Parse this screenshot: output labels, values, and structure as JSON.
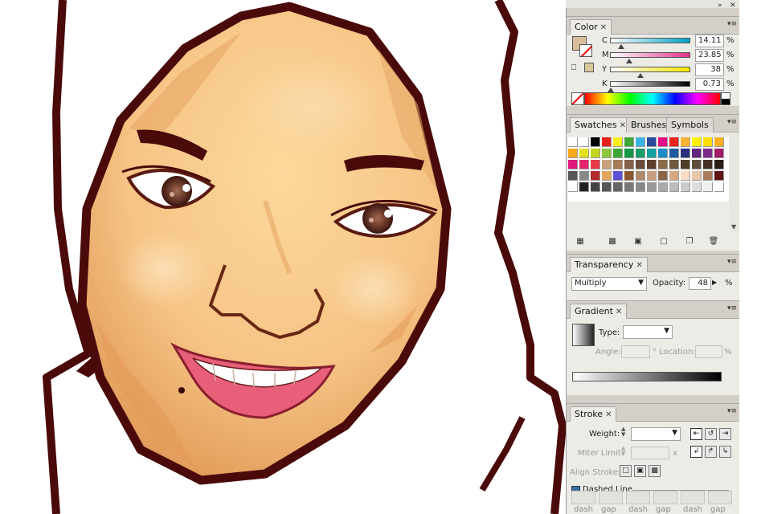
{
  "window": {
    "collapse_icon": "double-arrow-icon",
    "close_icon": "x-icon"
  },
  "color_panel": {
    "tab": "Color",
    "channels": [
      {
        "label": "C",
        "value": "14.11",
        "unit": "%",
        "gradient": [
          "#ffffff",
          "#00a0c6"
        ],
        "level": 0.1411
      },
      {
        "label": "M",
        "value": "23.85",
        "unit": "%",
        "gradient": [
          "#ffffff",
          "#e0338a"
        ],
        "level": 0.2385
      },
      {
        "label": "Y",
        "value": "38",
        "unit": "%",
        "gradient": [
          "#ffffff",
          "#f2e600"
        ],
        "level": 0.38
      },
      {
        "label": "K",
        "value": "0.73",
        "unit": "%",
        "gradient": [
          "#ffffff",
          "#000000"
        ],
        "level": 0.0073
      }
    ],
    "fill_color": "#d8bf9a",
    "stroke_color": "none",
    "spectrum": [
      "#ff0000",
      "#ffff00",
      "#00ff00",
      "#00ffff",
      "#0000ff",
      "#ff00ff",
      "#ff0000"
    ]
  },
  "swatches_panel": {
    "tabs": [
      "Swatches",
      "Brushes",
      "Symbols"
    ],
    "rows": [
      [
        "#ffffff",
        "#ffffff",
        "#000000",
        "#e6221b",
        "#f8ec1a",
        "#3fa535",
        "#3bb4e6",
        "#294b9c",
        "#e30e85",
        "#e7261c",
        "#f9b233",
        "#fff200",
        "#ffdd00",
        "#fab01d"
      ],
      [
        "#f7a81b",
        "#e4df1d",
        "#c5d41a",
        "#8cc63f",
        "#3ea535",
        "#149848",
        "#1a9c6b",
        "#15a1a0",
        "#1d8dc9",
        "#1e5aa0",
        "#29317d",
        "#62267f",
        "#7c2a8b",
        "#a01d66"
      ],
      [
        "#e0187b",
        "#e5246c",
        "#e83c4b",
        "#c9a27b",
        "#a47a57",
        "#86614b",
        "#6b4c3b",
        "#5e3d2b",
        "#8a6c4c",
        "#705a3c",
        "#4f3f2a",
        "#5f4b3b",
        "#452f22",
        "#2a1d13"
      ],
      [
        "#555555",
        "#888888",
        "#b22b2b",
        "#e3a65c",
        "#5b4fd6",
        "#8a5a2e",
        "#ae8b6a",
        "#c79f7f",
        "#8c6448",
        "#d5a882",
        "#fcdcc4",
        "#e6c7a9",
        "#a87c5c",
        "#5e1515"
      ],
      [
        "#ffffff",
        "#222222",
        "#444444",
        "#555555",
        "#666666",
        "#777777",
        "#888888",
        "#999999",
        "#aaaaaa",
        "#bbbbbb",
        "#cccccc",
        "#dddddd",
        "#eeeeee",
        "#ffffff"
      ]
    ],
    "footer_icons": [
      "swatch-libraries-icon",
      "show-kinds-icon",
      "swatch-options-icon",
      "new-color-group-icon",
      "new-swatch-icon",
      "delete-swatch-icon"
    ]
  },
  "transparency_panel": {
    "tab": "Transparency",
    "blend_mode": "Multiply",
    "opacity_label": "Opacity:",
    "opacity_value": "48",
    "opacity_unit": "%"
  },
  "gradient_panel": {
    "tab": "Gradient",
    "type_label": "Type:",
    "type_value": "",
    "angle_label": "Angle:",
    "angle_value": "",
    "angle_unit": "°",
    "location_label": "Location:",
    "location_value": "",
    "location_unit": "%"
  },
  "stroke_panel": {
    "tab": "Stroke",
    "weight_label": "Weight:",
    "weight_value": "",
    "miter_label": "Miter Limit:",
    "miter_value": "",
    "miter_unit": "x",
    "align_label": "Align Stroke:",
    "dashed_label": "Dashed Line",
    "dash_labels": [
      "dash",
      "gap",
      "dash",
      "gap",
      "dash",
      "gap"
    ]
  },
  "artwork": {
    "skin": "#f6c485",
    "outline": "#4a0a0a",
    "lip": "#e85f7a"
  }
}
